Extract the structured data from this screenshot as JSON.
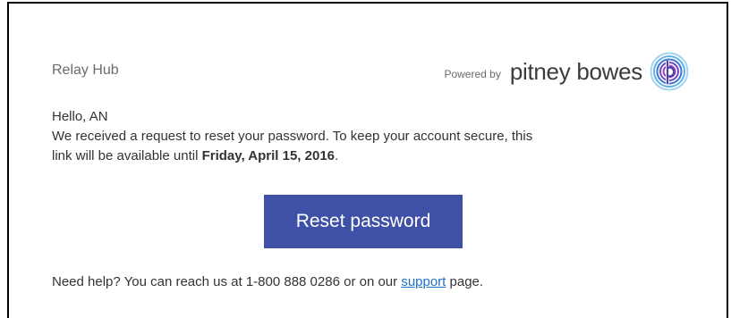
{
  "header": {
    "app_name": "Relay Hub",
    "powered_by": "Powered by",
    "brand_name": "pitney bowes",
    "brand_logo_icon": "pitney-bowes-logo-icon"
  },
  "message": {
    "greeting": "Hello, AN",
    "line1": "We received a request to reset your password. To keep your account secure, this",
    "line2_prefix": "link will be available until ",
    "expiry_date": "Friday, April 15, 2016",
    "line2_suffix": "."
  },
  "actions": {
    "reset_label": "Reset password"
  },
  "help": {
    "prefix": "Need help? You can reach us at 1-800 888 0286 or on our ",
    "link_label": "support",
    "suffix": " page."
  },
  "colors": {
    "button_bg": "#3f51a6",
    "link": "#1f6fc4",
    "text": "#333333",
    "muted": "#6b6b6b"
  }
}
